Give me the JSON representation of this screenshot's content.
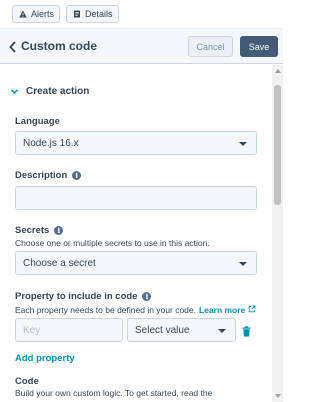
{
  "tabs": [
    {
      "label": "Alerts",
      "icon": "warning-icon"
    },
    {
      "label": "Details",
      "icon": "doc-icon"
    }
  ],
  "header": {
    "title": "Custom code",
    "cancel_label": "Cancel",
    "save_label": "Save"
  },
  "section": {
    "title": "Create action"
  },
  "language": {
    "label": "Language",
    "value": "Node.js 16.x"
  },
  "description": {
    "label": "Description",
    "value": ""
  },
  "secrets": {
    "label": "Secrets",
    "help": "Choose one or multiple secrets to use in this action.",
    "placeholder": "Choose a secret"
  },
  "property": {
    "label": "Property to include in code",
    "help": "Each property needs to be defined in your code.",
    "learn_more": "Learn more",
    "key_placeholder": "Key",
    "value_placeholder": "Select value",
    "add_label": "Add property"
  },
  "code": {
    "label": "Code",
    "help": "Build your own custom logic. To get started, read the"
  },
  "colors": {
    "accent": "#0091ae",
    "primary_button": "#425b76",
    "text": "#33475b"
  }
}
